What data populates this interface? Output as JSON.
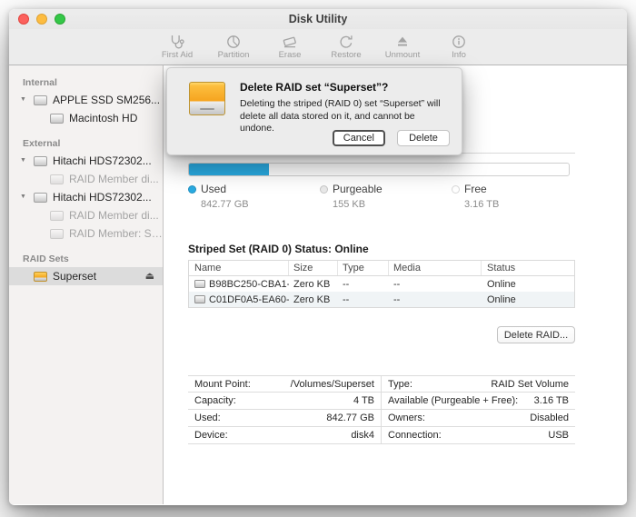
{
  "window": {
    "title": "Disk Utility"
  },
  "icons": {
    "disclosure": "▼",
    "eject": "⏏"
  },
  "toolbar": {
    "buttons": [
      {
        "label": "First Aid"
      },
      {
        "label": "Partition"
      },
      {
        "label": "Erase"
      },
      {
        "label": "Restore"
      },
      {
        "label": "Unmount"
      },
      {
        "label": "Info"
      }
    ]
  },
  "sidebar": {
    "sections": [
      {
        "title": "Internal",
        "items": [
          {
            "label": "APPLE SSD SM256..."
          },
          {
            "label": "Macintosh HD"
          }
        ]
      },
      {
        "title": "External",
        "items": [
          {
            "label": "Hitachi HDS72302..."
          },
          {
            "label": "RAID Member di..."
          },
          {
            "label": "Hitachi HDS72302..."
          },
          {
            "label": "RAID Member di..."
          },
          {
            "label": "RAID Member: Sup..."
          }
        ]
      },
      {
        "title": "RAID Sets",
        "items": [
          {
            "label": "Superset"
          }
        ]
      }
    ]
  },
  "dialog": {
    "title": "Delete RAID set “Superset”?",
    "message": "Deleting the striped (RAID 0) set “Superset” will delete all data stored on it, and cannot be undone.",
    "cancel_label": "Cancel",
    "delete_label": "Delete"
  },
  "usage": {
    "used_percent": 21,
    "segments": [
      {
        "label": "Used",
        "value": "842.77 GB",
        "color": "#29abe2"
      },
      {
        "label": "Purgeable",
        "value": "155 KB",
        "color": "#e9e9e9"
      },
      {
        "label": "Free",
        "value": "3.16 TB",
        "color": "#ffffff"
      }
    ]
  },
  "raid": {
    "status_label": "Striped Set (RAID 0) Status: Online",
    "table": {
      "columns": [
        "Name",
        "Size",
        "Type",
        "Media",
        "Status"
      ],
      "rows": [
        {
          "name": "B98BC250-CBA1-...",
          "size": "Zero KB",
          "type": "--",
          "media": "--",
          "status": "Online"
        },
        {
          "name": "C01DF0A5-EA60-...",
          "size": "Zero KB",
          "type": "--",
          "media": "--",
          "status": "Online"
        }
      ]
    },
    "delete_button": "Delete RAID..."
  },
  "info": {
    "rows": [
      [
        {
          "label": "Mount Point:",
          "value": "/Volumes/Superset"
        },
        {
          "label": "Type:",
          "value": "RAID Set Volume"
        }
      ],
      [
        {
          "label": "Capacity:",
          "value": "4 TB"
        },
        {
          "label": "Available (Purgeable + Free):",
          "value": "3.16 TB"
        }
      ],
      [
        {
          "label": "Used:",
          "value": "842.77 GB"
        },
        {
          "label": "Owners:",
          "value": "Disabled"
        }
      ],
      [
        {
          "label": "Device:",
          "value": "disk4"
        },
        {
          "label": "Connection:",
          "value": "USB"
        }
      ]
    ]
  },
  "colors": {
    "accent_blue": "#29abe2",
    "drive_orange": "#f5a623"
  }
}
